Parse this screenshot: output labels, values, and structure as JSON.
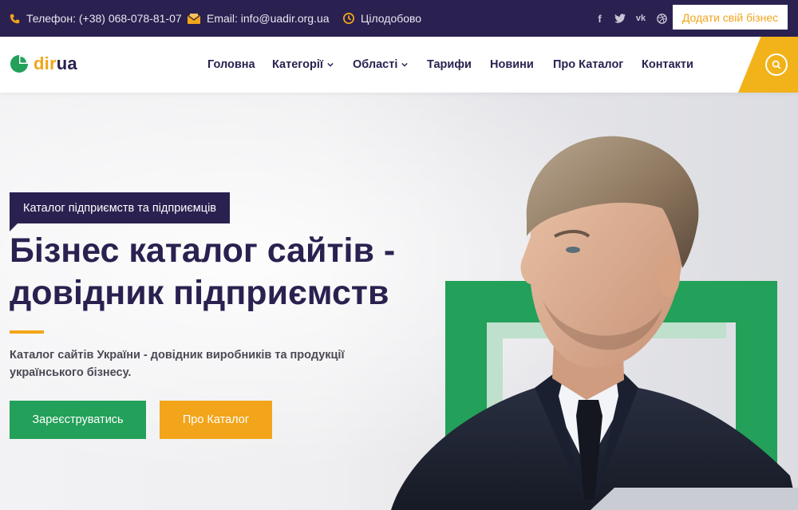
{
  "topbar": {
    "phone": "Телефон: (+38) 068-078-81-07",
    "email": "Email: info@uadir.org.ua",
    "hours": "Цілодобово",
    "socials": [
      "facebook-icon",
      "twitter-icon",
      "vk-icon",
      "dribbble-icon"
    ],
    "add_business": "Додати свій бізнес"
  },
  "logo": {
    "part1": "dir",
    "part2": "ua"
  },
  "nav": {
    "items": [
      {
        "label": "Головна",
        "dropdown": false
      },
      {
        "label": "Категорії",
        "dropdown": true
      },
      {
        "label": "Області",
        "dropdown": true
      },
      {
        "label": "Тарифи",
        "dropdown": false
      },
      {
        "label": "Новини",
        "dropdown": false
      },
      {
        "label": "Про Каталог",
        "dropdown": false
      },
      {
        "label": "Контакти",
        "dropdown": false
      }
    ]
  },
  "hero": {
    "badge": "Каталог підприємств та підприємців",
    "title_line1": "Бізнес каталог сайтів -",
    "title_line2": "довідник підприємств",
    "subtitle_line1": "Каталог сайтів України - довідник виробників та продукції",
    "subtitle_line2": "українського бізнесу.",
    "btn_register": "Зареєструватись",
    "btn_about": "Про Каталог"
  },
  "colors": {
    "primary": "#2b2150",
    "accent": "#f2a51a",
    "green": "#23a059"
  }
}
